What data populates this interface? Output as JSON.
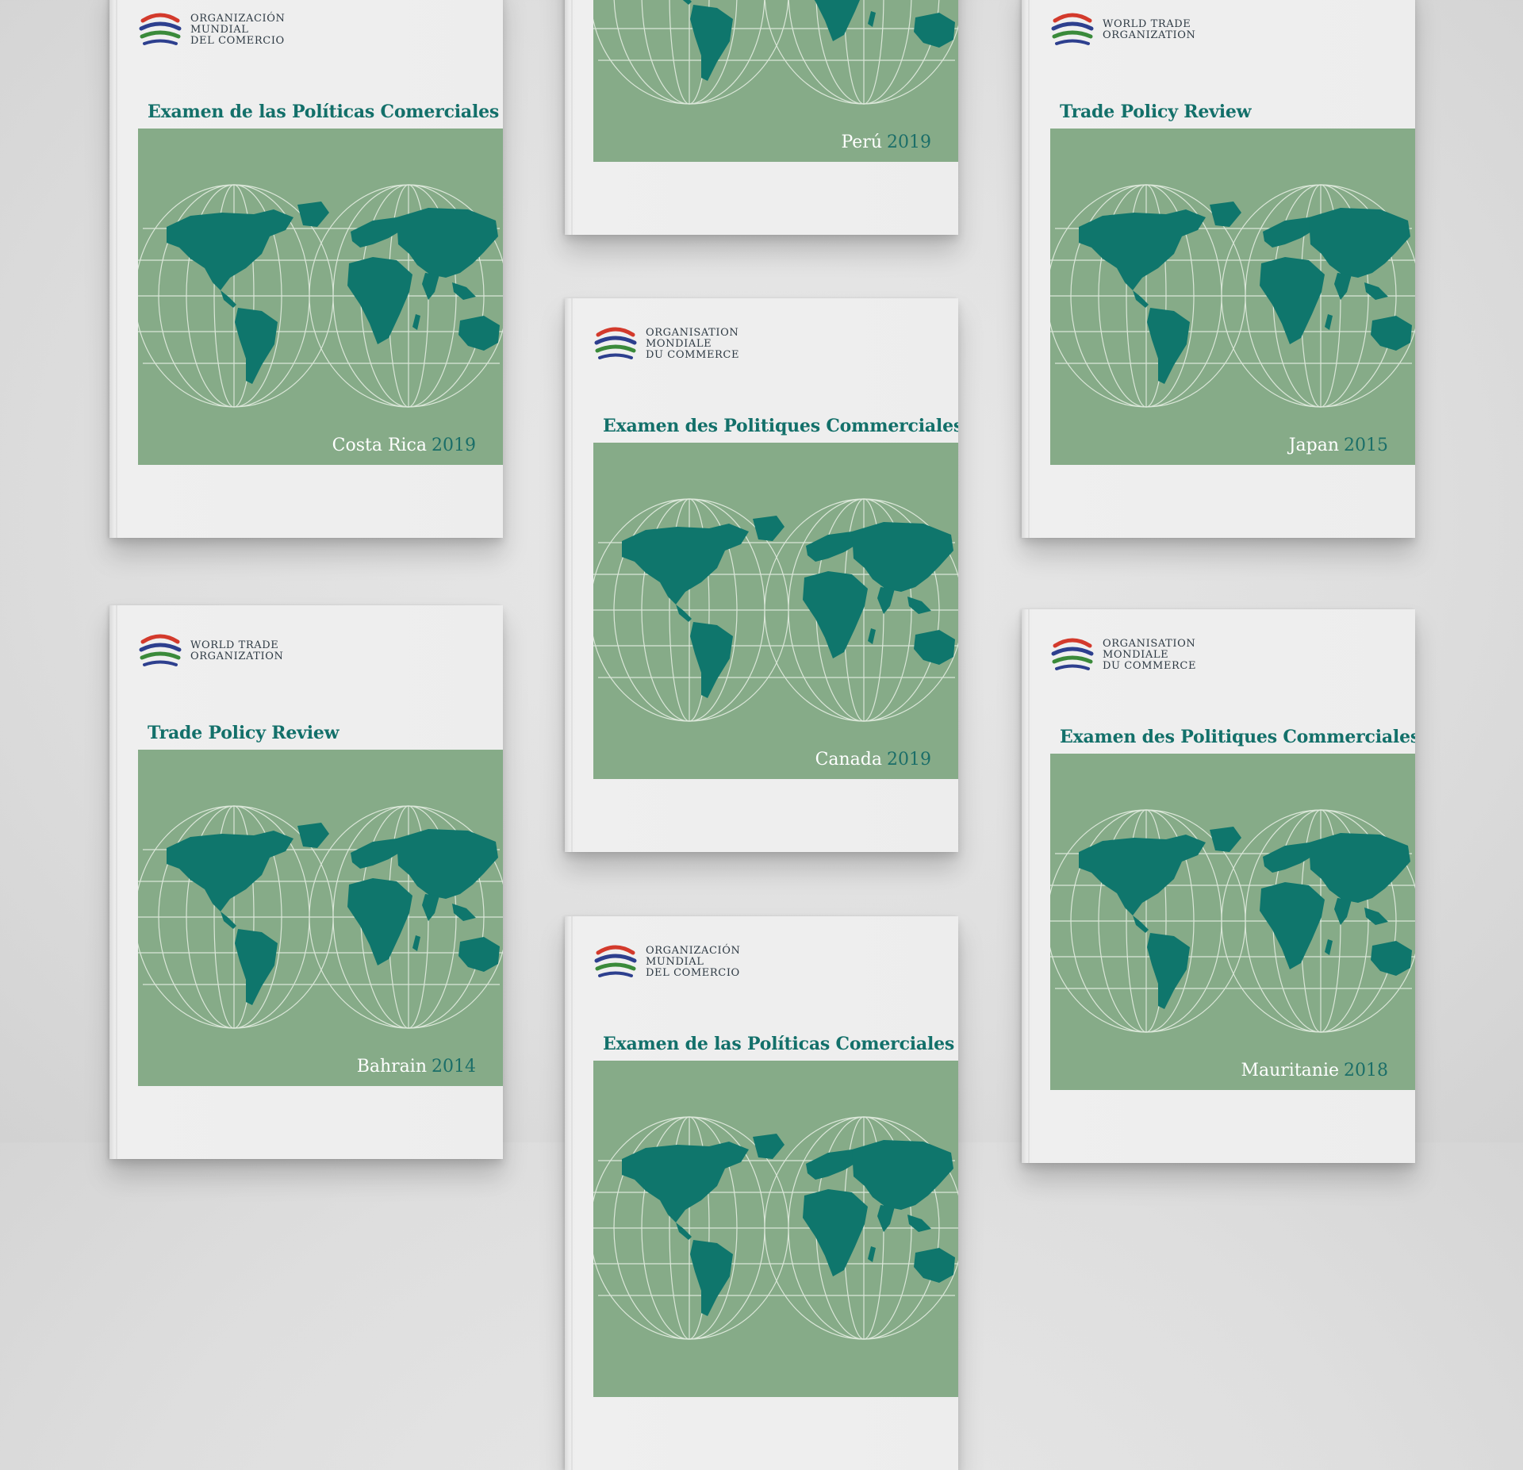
{
  "covers": [
    {
      "id": "costa-rica",
      "org_lines": [
        "Organización",
        "Mundial",
        "del Comercio"
      ],
      "series_title": "Examen de las Políticas Comerciales",
      "country": "Costa Rica",
      "year": "2019"
    },
    {
      "id": "peru",
      "org_lines": [],
      "series_title": "",
      "country": "Perú",
      "year": "2019"
    },
    {
      "id": "japan",
      "org_lines": [
        "World Trade",
        "Organization"
      ],
      "series_title": "Trade Policy Review",
      "country": "Japan",
      "year": "2015"
    },
    {
      "id": "canada",
      "org_lines": [
        "Organisation",
        "Mondiale",
        "du Commerce"
      ],
      "series_title": "Examen des Politiques Commerciales",
      "country": "Canada",
      "year": "2019"
    },
    {
      "id": "bahrain",
      "org_lines": [
        "World Trade",
        "Organization"
      ],
      "series_title": "Trade Policy Review",
      "country": "Bahrain",
      "year": "2014"
    },
    {
      "id": "mauritanie",
      "org_lines": [
        "Organisation",
        "Mondiale",
        "du Commerce"
      ],
      "series_title": "Examen des Politiques Commerciales",
      "country": "Mauritanie",
      "year": "2018"
    },
    {
      "id": "bottom-es",
      "org_lines": [
        "Organización",
        "Mundial",
        "del Comercio"
      ],
      "series_title": "Examen de las Políticas Comerciales",
      "country": "",
      "year": ""
    }
  ],
  "colors": {
    "panel_green": "#86ab88",
    "continent_teal": "#0f766c",
    "title_teal": "#13706a",
    "year_teal": "#1b6e68",
    "logo_red": "#d33a2c",
    "logo_blue": "#2d3f8e",
    "logo_green": "#3a8a3a"
  },
  "icons": [
    "wto-logo-icon",
    "world-map-globes"
  ]
}
